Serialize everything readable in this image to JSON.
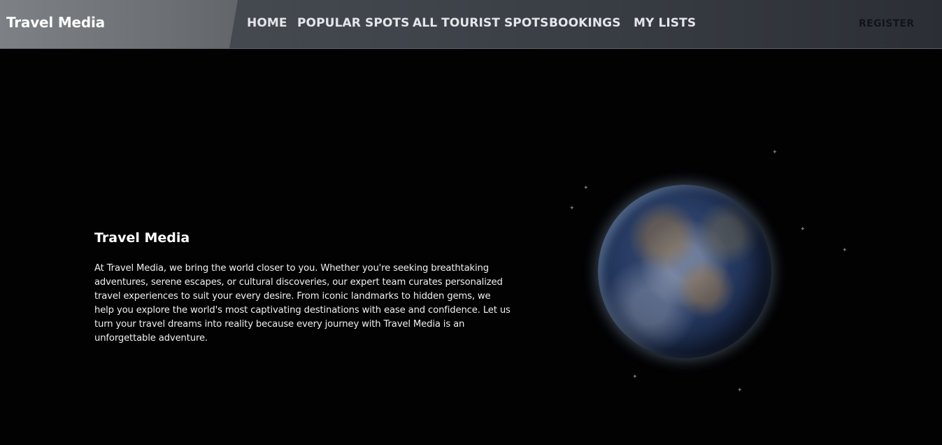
{
  "brand": "Travel Media",
  "nav": {
    "items": [
      {
        "label": "HOME"
      },
      {
        "label": "POPULAR SPOTS"
      },
      {
        "label": "ALL TOURIST SPOTS"
      },
      {
        "label": "BOOKINGS"
      },
      {
        "label": "MY LISTS"
      }
    ],
    "register": "REGISTER"
  },
  "hero": {
    "title": "Travel Media",
    "text": "At Travel Media, we bring the world closer to you. Whether you're seeking breathtaking adventures, serene escapes, or cultural discoveries, our expert team curates personalized travel experiences to suit your every desire. From iconic landmarks to hidden gems, we help you explore the world's most captivating destinations with ease and confidence. Let us turn your travel dreams into reality because every journey with Travel Media is an unforgettable adventure.",
    "image": "earth-globe"
  },
  "colors": {
    "background": "#020203",
    "navbar": "#3f444b",
    "text": "#ffffff"
  }
}
